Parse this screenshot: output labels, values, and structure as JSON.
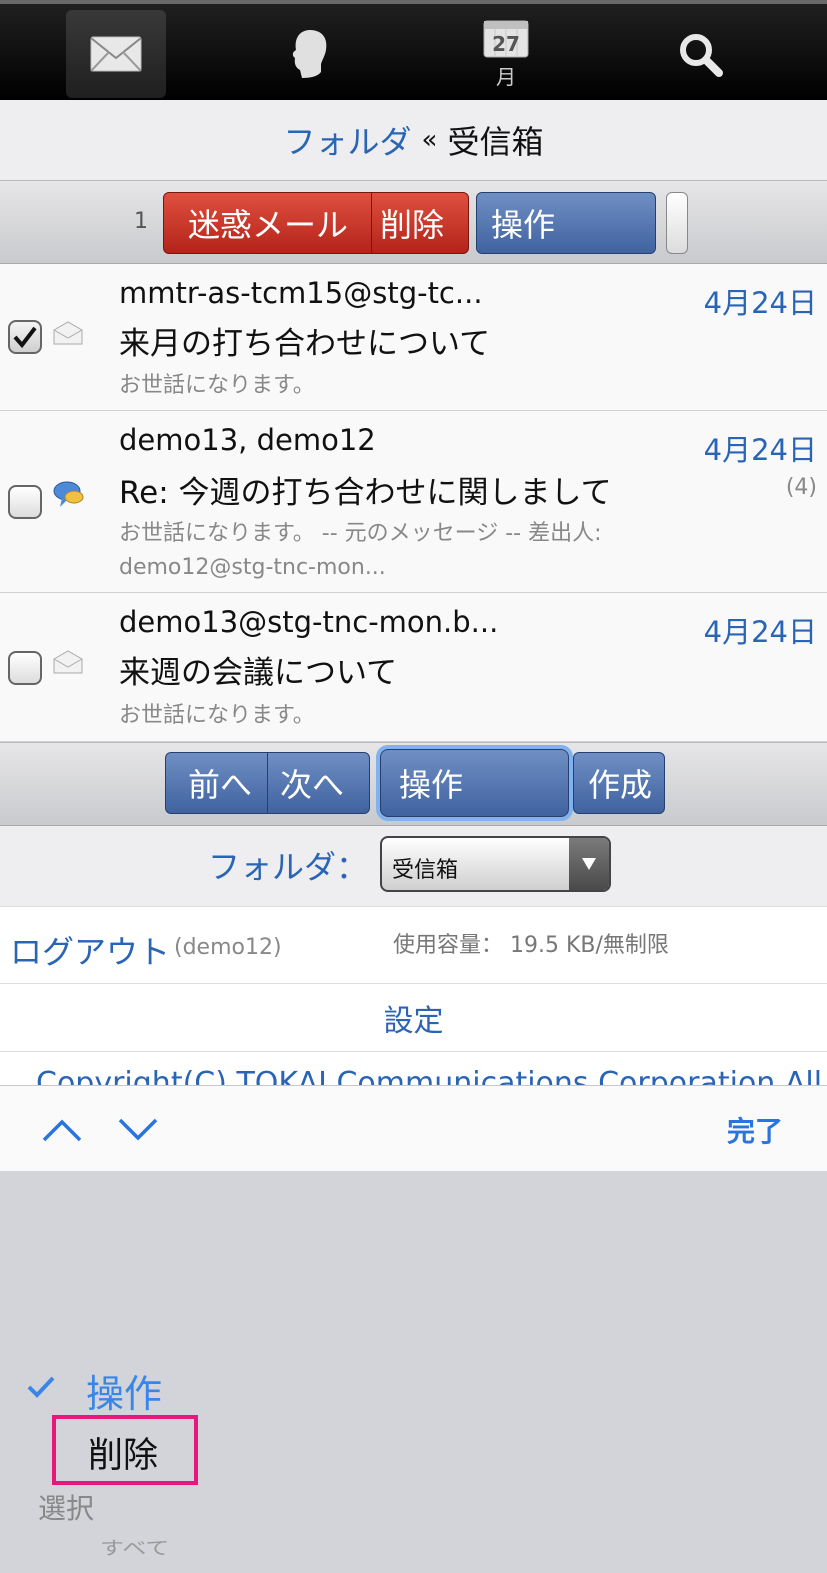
{
  "nav": {
    "tabs": [
      {
        "name": "mail",
        "icon": "envelope-icon",
        "active": true
      },
      {
        "name": "address",
        "icon": "person-icon"
      },
      {
        "name": "calendar",
        "icon": "calendar-icon",
        "day": "27",
        "label": "月"
      },
      {
        "name": "search",
        "icon": "search-icon"
      }
    ]
  },
  "header": {
    "folder_link": "フォルダ",
    "separator": "«",
    "current": "受信箱"
  },
  "toolbar_top": {
    "selected_count": "1",
    "spam_label": "迷惑メール",
    "delete_label": "削除",
    "action_label": "操作"
  },
  "mails": [
    {
      "checked": true,
      "icon": "envelope-open-icon",
      "sender": "mmtr-as-tcm15@stg-tc...",
      "subject": "来月の打ち合わせについて",
      "preview": "お世話になります。",
      "date": "4月24日"
    },
    {
      "checked": false,
      "icon": "thread-bubble-icon",
      "sender": "demo13, demo12",
      "subject": "Re: 今週の打ち合わせに関しまして",
      "preview": "お世話になります。 -- 元のメッセージ -- 差出人:",
      "preview2": "demo12@stg-tnc-mon...",
      "date": "4月24日",
      "count": "(4)"
    },
    {
      "checked": false,
      "icon": "envelope-open-icon",
      "sender": "demo13@stg-tnc-mon.b...",
      "subject": "来週の会議について",
      "preview": "お世話になります。",
      "date": "4月24日"
    }
  ],
  "toolbar_bottom": {
    "prev_label": "前へ",
    "next_label": "次へ",
    "action_label": "操作",
    "compose_label": "作成"
  },
  "folder_select": {
    "label": "フォルダ：",
    "value": "受信箱"
  },
  "account": {
    "logout_label": "ログアウト",
    "user": "(demo12)",
    "usage": "使用容量： 19.5 KB/無制限"
  },
  "settings_label": "設定",
  "copyright": "Copyright(C) TOKAI Communications Corporation All",
  "accessory": {
    "done_label": "完了"
  },
  "picker": {
    "selected": "操作",
    "options": [
      "削除",
      "選択",
      "すべて"
    ]
  },
  "colors": {
    "link": "#2a64b5",
    "red_button": "#c33224",
    "blue_button": "#4f70ad",
    "highlight": "#e6187e",
    "picker_bg": "#d2d4d9"
  }
}
